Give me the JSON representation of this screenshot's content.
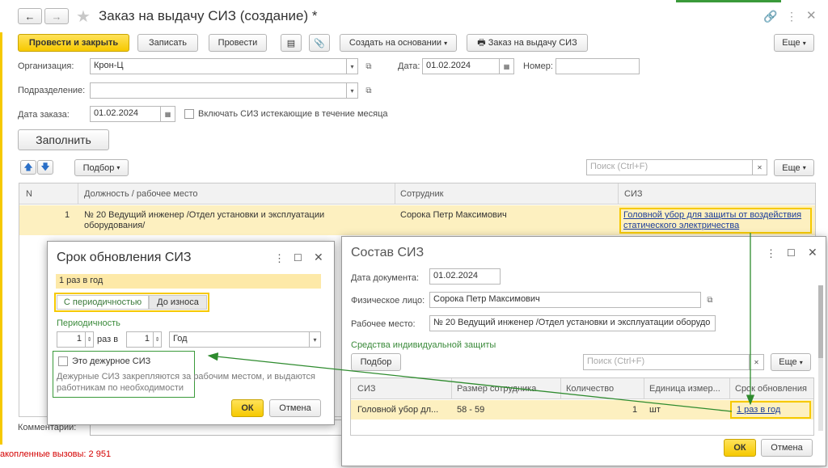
{
  "window": {
    "title": "Заказ на выдачу СИЗ (создание) *"
  },
  "toolbar": {
    "post_close": "Провести и закрыть",
    "save": "Записать",
    "post": "Провести",
    "create_based": "Создать на основании",
    "print_order": "Заказ на выдачу СИЗ",
    "more": "Еще"
  },
  "form": {
    "org_label": "Организация:",
    "org_value": "Крон-Ц",
    "date_label": "Дата:",
    "date_value": "01.02.2024",
    "number_label": "Номер:",
    "number_value": "",
    "division_label": "Подразделение:",
    "division_value": "",
    "order_date_label": "Дата заказа:",
    "order_date_value": "01.02.2024",
    "include_expiring_label": "Включать СИЗ истекающие в течение месяца",
    "fill_button": "Заполнить",
    "selection_button": "Подбор",
    "search_placeholder": "Поиск (Ctrl+F)",
    "more": "Еще",
    "comment_label": "Комментарий:"
  },
  "table": {
    "headers": [
      "N",
      "Должность / рабочее место",
      "Сотрудник",
      "СИЗ"
    ],
    "rows": [
      {
        "n": "1",
        "position": "№ 20 Ведущий инженер /Отдел установки и эксплуатации оборудования/",
        "employee": "Сорока Петр Максимович",
        "siz": "Головной убор для защиты от воздействия статического электричества"
      }
    ]
  },
  "status_bar": {
    "text": "акопленные вызовы: 2 951"
  },
  "dialog_period": {
    "title": "Срок обновления СИЗ",
    "value_text": "1 раз в год",
    "tab_periodic": "С периодичностью",
    "tab_wear": "До износа",
    "periodicity_label": "Периодичность",
    "count_value": "1",
    "times_in": "раз в",
    "interval_value": "1",
    "unit_value": "Год",
    "duty_label": "Это дежурное СИЗ",
    "duty_hint": "Дежурные СИЗ закрепляются за рабочим местом, и выдаются работникам по необходимости",
    "ok": "ОК",
    "cancel": "Отмена"
  },
  "dialog_composition": {
    "title": "Состав СИЗ",
    "doc_date_label": "Дата документа:",
    "doc_date_value": "01.02.2024",
    "person_label": "Физическое лицо:",
    "person_value": "Сорока Петр Максимович",
    "workplace_label": "Рабочее место:",
    "workplace_value": "№ 20 Ведущий инженер /Отдел установки и эксплуатации оборудо",
    "section_title": "Средства индивидуальной защиты",
    "selection_button": "Подбор",
    "search_placeholder": "Поиск (Ctrl+F)",
    "more": "Еще",
    "headers": [
      "СИЗ",
      "Размер сотрудника",
      "Количество",
      "Единица измер...",
      "Срок обновления"
    ],
    "row": {
      "siz": "Головной убор дл...",
      "size": "58 - 59",
      "qty": "1",
      "unit": "шт",
      "period": "1 раз в год"
    },
    "ok": "ОК",
    "cancel": "Отмена"
  },
  "colors": {
    "accent_yellow": "#f6c900",
    "row_highlight": "#fdf0c0",
    "annotation_green": "#2e8b2e",
    "link_blue": "#1a3c9b",
    "status_red": "#d40000"
  }
}
